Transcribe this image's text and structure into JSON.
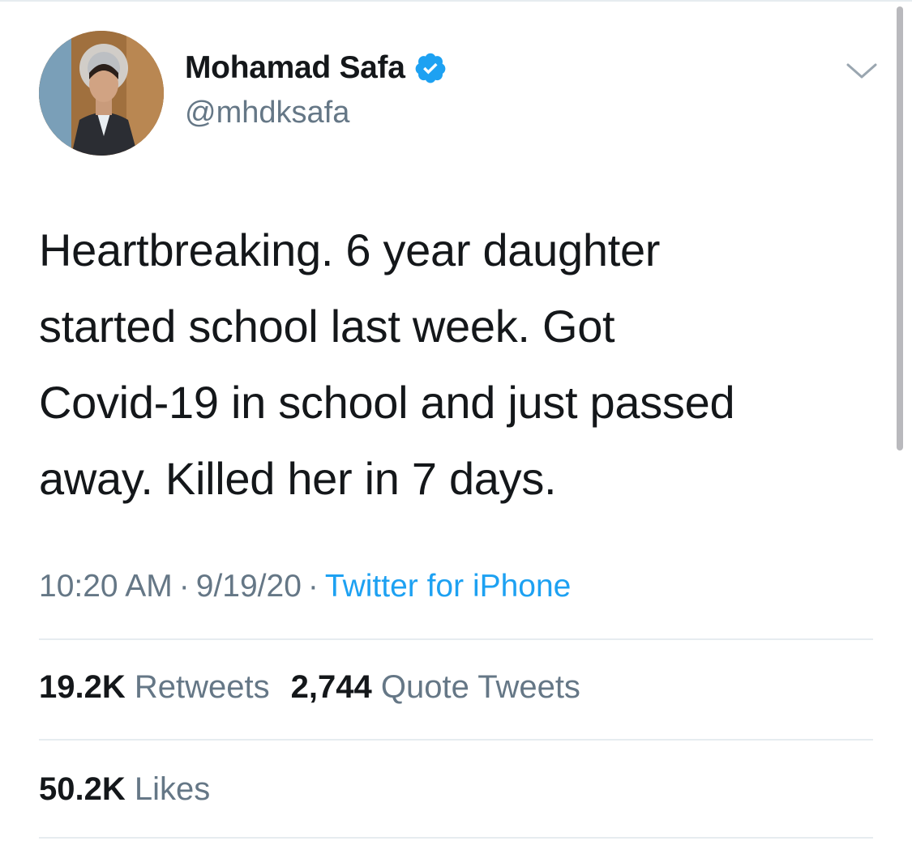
{
  "user": {
    "display_name": "Mohamad Safa",
    "handle": "@mhdksafa",
    "verified": true,
    "avatar": "profile-photo"
  },
  "tweet": {
    "lines": [
      "Heartbreaking. 6 year daughter",
      "started school last week. Got",
      "Covid-19 in school and just passed",
      "away. Killed her in 7 days."
    ],
    "time": "10:20 AM",
    "date": "9/19/20",
    "separator": "·",
    "source": "Twitter for iPhone"
  },
  "stats": {
    "retweets_count": "19.2K",
    "retweets_label": "Retweets",
    "quotes_count": "2,744",
    "quotes_label": "Quote Tweets",
    "likes_count": "50.2K",
    "likes_label": "Likes"
  },
  "icons": {
    "verified": "verified-badge-icon",
    "more": "chevron-down-icon"
  },
  "colors": {
    "text": "#14171a",
    "secondary": "#657786",
    "accent": "#1da1f2",
    "divider": "#e6ecf0"
  }
}
